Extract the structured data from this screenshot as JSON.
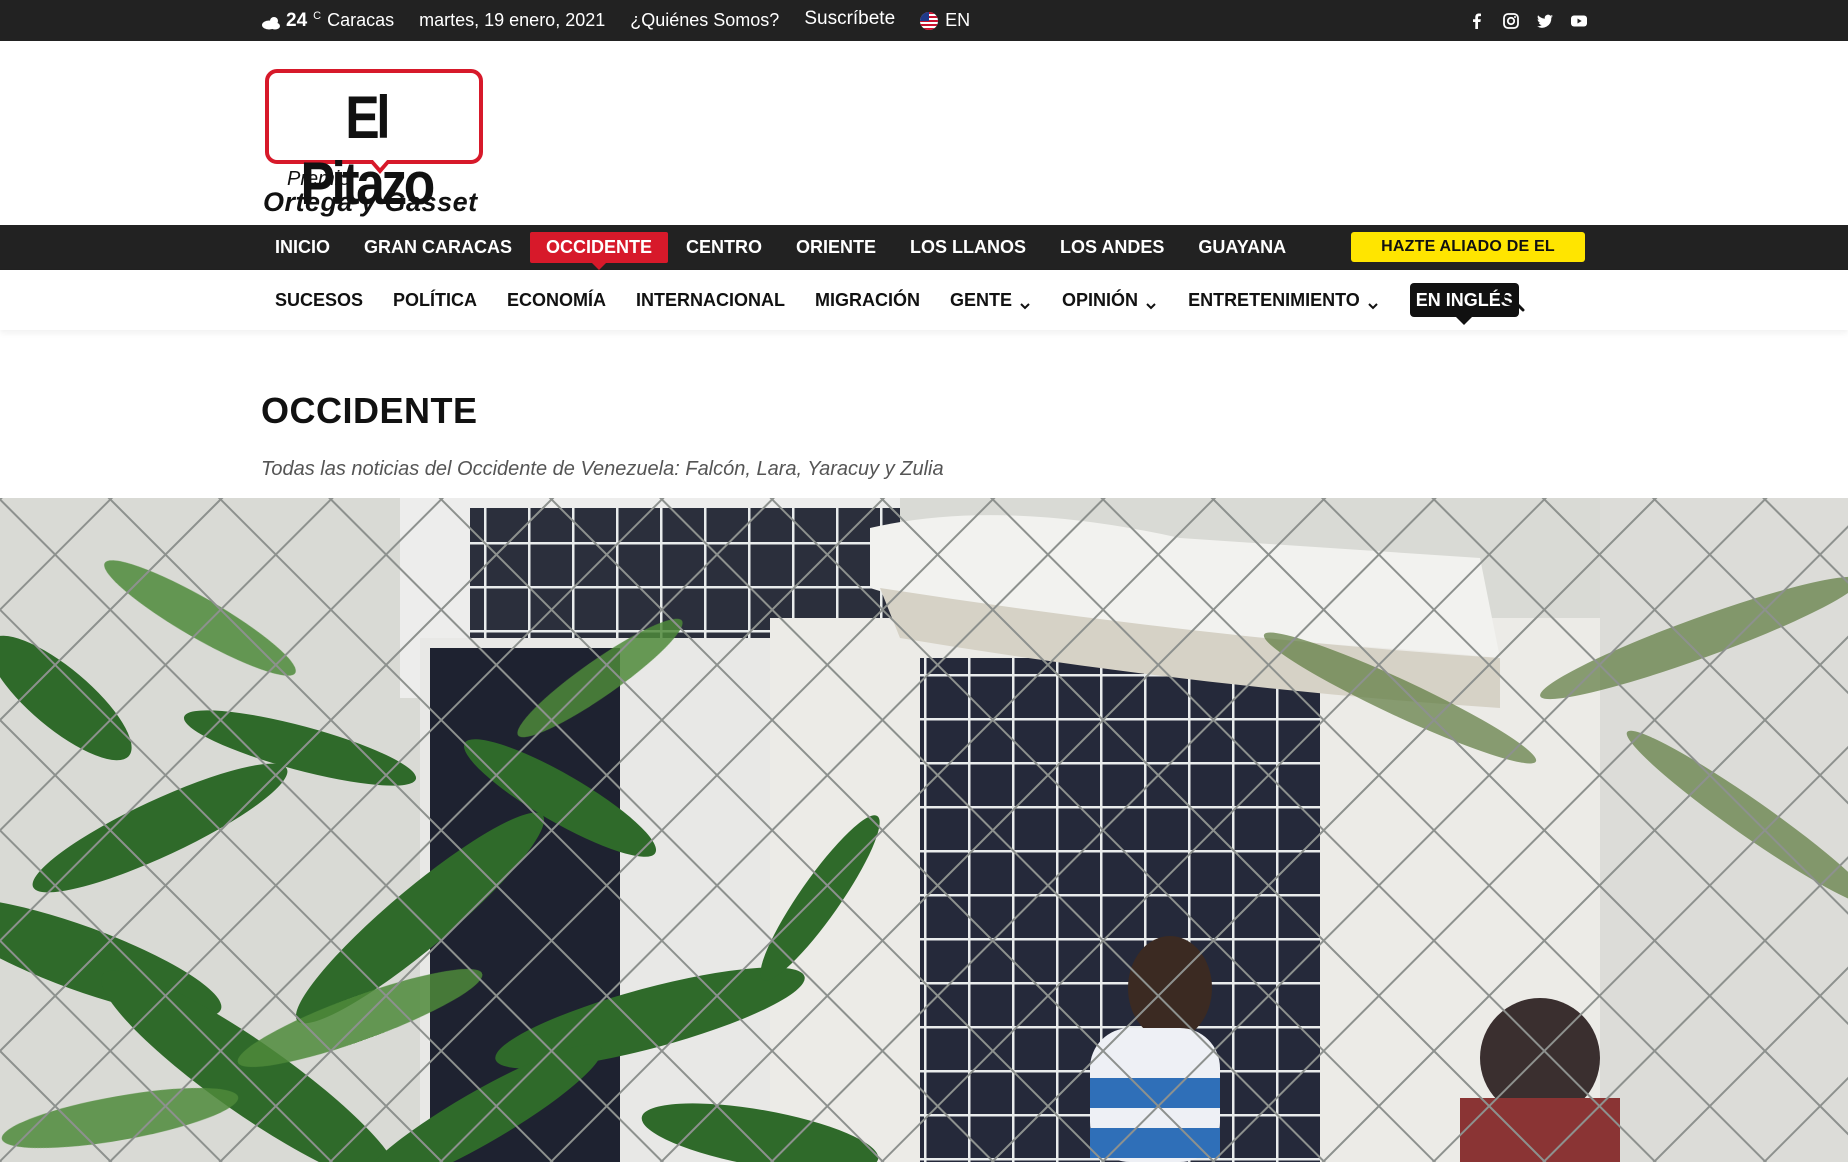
{
  "topbar": {
    "weather_icon": "cloud-sun-icon",
    "temperature": "24",
    "temp_unit": "C",
    "city": "Caracas",
    "date": "martes, 19 enero, 2021",
    "about_link": "¿Quiénes Somos?",
    "subscribe_link": "Suscríbete",
    "language": "EN",
    "language_flag_icon": "us-flag-icon",
    "social_icons": [
      "facebook-icon",
      "instagram-icon",
      "twitter-icon",
      "youtube-icon"
    ]
  },
  "logo": {
    "name": "El Pitazo",
    "premio": "Premio",
    "award": "Ortega y Gasset"
  },
  "main_nav": {
    "items": [
      "INICIO",
      "GRAN CARACAS",
      "OCCIDENTE",
      "CENTRO",
      "ORIENTE",
      "LOS LLANOS",
      "LOS ANDES",
      "GUAYANA"
    ],
    "active": "OCCIDENTE",
    "cta": "HAZTE ALIADO DE EL PITAZO"
  },
  "sub_nav": {
    "items": [
      "SUCESOS",
      "POLÍTICA",
      "ECONOMÍA",
      "INTERNACIONAL",
      "MIGRACIÓN",
      "GENTE",
      "OPINIÓN",
      "ENTRETENIMIENTO"
    ],
    "dropdown_items": [
      "GENTE",
      "OPINIÓN",
      "ENTRETENIMIENTO"
    ],
    "highlight": "EN INGLÉS",
    "search_icon": "search-icon"
  },
  "category": {
    "title": "OCCIDENTE",
    "description": "Todas las noticias del Occidente de Venezuela: Falcón, Lara, Yaracuy y Zulia"
  },
  "colors": {
    "brand_red": "#d7192a",
    "dark_bar": "#222222",
    "cta_yellow": "#ffe500"
  }
}
